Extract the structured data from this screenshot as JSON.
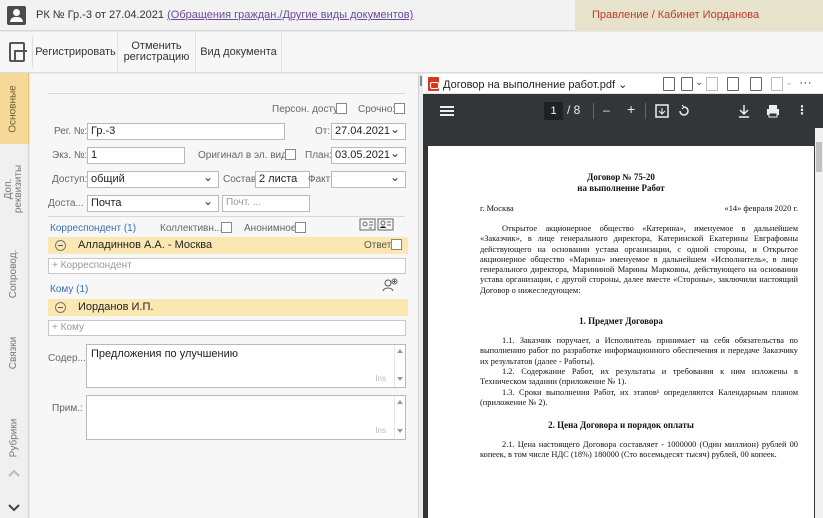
{
  "titlebar": {
    "doc_title": "РК № Гр.-3 от 27.04.2021 ",
    "doc_link": "(Обращения граждан./Другие виды документов)",
    "org_cabinet": "Правление / Кабинет Иорданова"
  },
  "toolbar": {
    "register": "Регистрировать",
    "cancel_line1": "Отменить",
    "cancel_line2": "регистрацию",
    "doc_type": "Вид документа"
  },
  "side_tabs": [
    {
      "label": "Основные",
      "active": true
    },
    {
      "label": "Доп. реквизиты",
      "active": false
    },
    {
      "label": "Сопровод.",
      "active": false
    },
    {
      "label": "Связки",
      "active": false
    },
    {
      "label": "Рубрики",
      "active": false
    }
  ],
  "form": {
    "access_personal_label": "Персон. доступ:",
    "urgent_label": "Срочно:",
    "reg_no_label": "Рег. №:",
    "reg_no_value": "Гр.-3",
    "from_label": "От:",
    "from_value": "27.04.2021",
    "copy_no_label": "Экз. №:",
    "copy_no_value": "1",
    "original_label": "Оригинал в эл. виде:",
    "plan_label": "План:",
    "plan_value": "03.05.2021",
    "access_label": "Доступ:",
    "access_value": "общий",
    "composition_label": "Состав:",
    "composition_value": "2 листа",
    "fact_label": "Факт:",
    "delivery_label": "Доста...",
    "delivery_value": "Почта",
    "postal_placeholder": "Почт. ...",
    "correspondent_label": "Корреспондент (1)",
    "collective_label": "Коллективн...",
    "anonymous_label": "Анонимное:",
    "correspondent_name": "Алладиннов А.А. - Москва",
    "answer_label": "Ответ:",
    "add_correspondent": "+ Корреспондент",
    "to_label": "Кому (1)",
    "to_name": "Иорданов И.П.",
    "add_to": "+ Кому",
    "content_label": "Содер...",
    "content_value": "Предложения по улучшению",
    "note_label": "Прим.:",
    "ins": "Ins"
  },
  "viewer": {
    "file_name": "Договор на выполнение работ.pdf",
    "page_current": "1",
    "page_total": "/ 8",
    "doc": {
      "heading1": "Договор № 75-20",
      "heading2": "на выполнение Работ",
      "city": "г. Москва",
      "date": "«14» февраля 2020 г.",
      "intro": "Открытое акционерное общество «Катерина», именуемое в дальнейшем «Заказчик», в лице генерального директора, Катеринской Екатерины Евграфовны действующего на основании устава организации, с одной стороны, и Открытое акционерное общество «Марина» именуемое в дальнейшем «Исполнитель», в лице генерального директора, Марининой Марины Марковны, действующего на основании устава организации, с другой стороны, далее вместе «Стороны», заключили настоящий Договор о нижеследующем:",
      "section1": "1. Предмет Договора",
      "p11": "1.1. Заказчик поручает, а Исполнитель принимает на себя обязательства по выполнению работ по разработке информационного обеспечения и передаче Заказчику их результатов (далее - Работы).",
      "p12": "1.2. Содержание Работ, их результаты и требования к ним изложены в Техническом задании (приложение № 1).",
      "p13": "1.3. Сроки выполнения Работ, их этапов¹ определяются Календарным планом (приложение № 2).",
      "section2": "2. Цена Договора и порядок оплаты",
      "p21": "2.1. Цена настоящего Договора составляет - 1000000 (Один миллион) рублей 00 копеек, в том числе НДС (18%) 180000 (Сто восемьдесят тысяч) рублей, 00 копеек."
    }
  }
}
